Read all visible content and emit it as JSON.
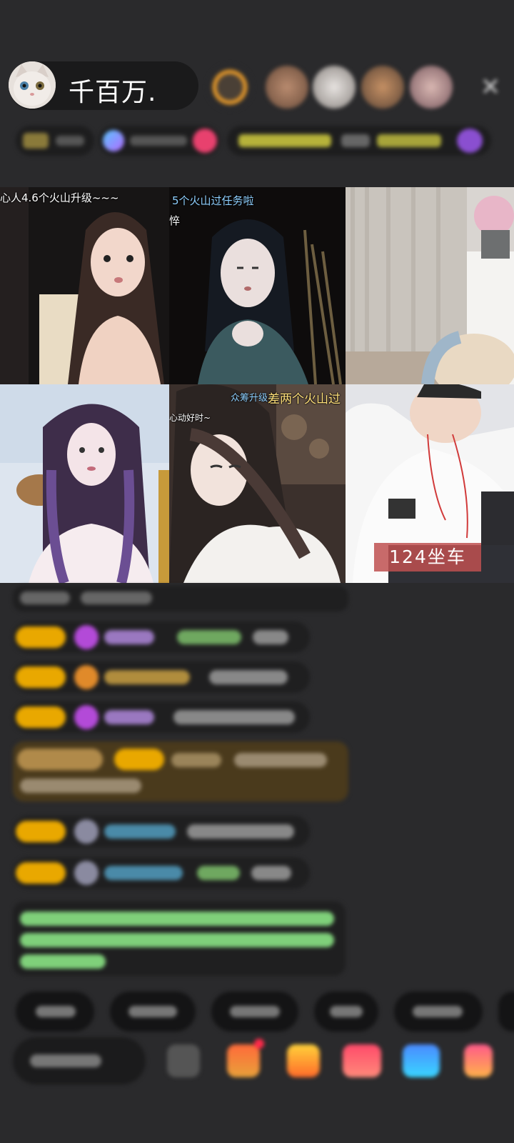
{
  "host": {
    "name": "千百万."
  },
  "video_grid": {
    "cells": [
      {
        "overlay": "心人4.6个火山升级~~~"
      },
      {
        "overlay": "5个火山过任务啦",
        "overlay2": "悴"
      },
      {
        "overlay": ""
      },
      {
        "overlay": ""
      },
      {
        "overlay": "众筹升级~",
        "overlay2": "差两个火山过",
        "overlay3": "心动好时~"
      },
      {
        "seat_label": "124坐车"
      }
    ]
  },
  "colors": {
    "background": "#2a2a2c",
    "badge_gold": "#e9a800",
    "gem_purple": "#b34ad8",
    "highlight_message": "#4a3a1c",
    "system_text": "#7fd07a"
  },
  "icons": [
    "close-icon",
    "gift-icon",
    "shop-icon",
    "heart-icon",
    "share-icon",
    "more-icon"
  ]
}
